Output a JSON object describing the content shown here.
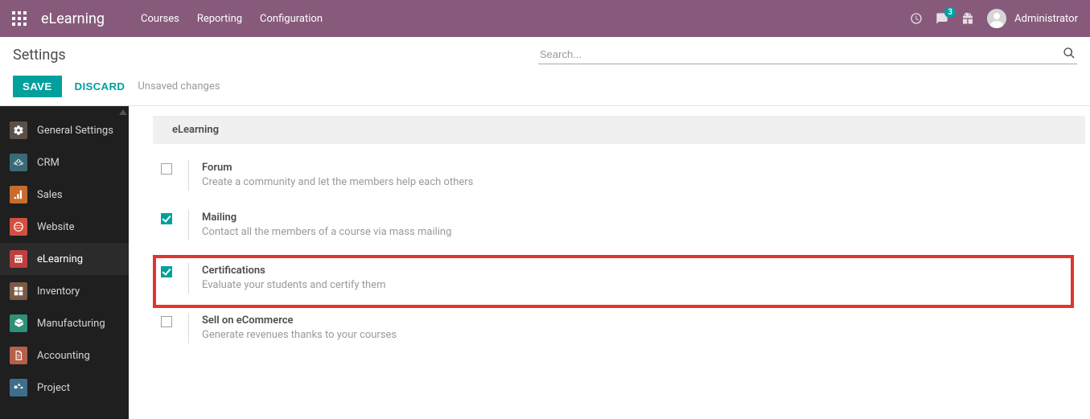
{
  "navbar": {
    "brand": "eLearning",
    "links": [
      "Courses",
      "Reporting",
      "Configuration"
    ],
    "badge_count": "3",
    "username": "Administrator"
  },
  "control": {
    "title": "Settings",
    "search_placeholder": "Search...",
    "save_label": "SAVE",
    "discard_label": "DISCARD",
    "unsaved_label": "Unsaved changes"
  },
  "sidebar": {
    "items": [
      {
        "label": "General Settings",
        "color": "#5b5048"
      },
      {
        "label": "CRM",
        "color": "#3a6a77"
      },
      {
        "label": "Sales",
        "color": "#c76c2e"
      },
      {
        "label": "Website",
        "color": "#d15140"
      },
      {
        "label": "eLearning",
        "color": "#bd3f3e"
      },
      {
        "label": "Inventory",
        "color": "#7b5a47"
      },
      {
        "label": "Manufacturing",
        "color": "#2f8f78"
      },
      {
        "label": "Accounting",
        "color": "#b3614a"
      },
      {
        "label": "Project",
        "color": "#3f6e8c"
      }
    ],
    "active_index": 4
  },
  "section": {
    "title": "eLearning",
    "settings": [
      {
        "title": "Forum",
        "desc": "Create a community and let the members help each others",
        "checked": false,
        "highlight": false
      },
      {
        "title": "Mailing",
        "desc": "Contact all the members of a course via mass mailing",
        "checked": true,
        "highlight": false
      },
      {
        "title": "Certifications",
        "desc": "Evaluate your students and certify them",
        "checked": true,
        "highlight": true
      },
      {
        "title": "Sell on eCommerce",
        "desc": "Generate revenues thanks to your courses",
        "checked": false,
        "highlight": false
      }
    ]
  }
}
